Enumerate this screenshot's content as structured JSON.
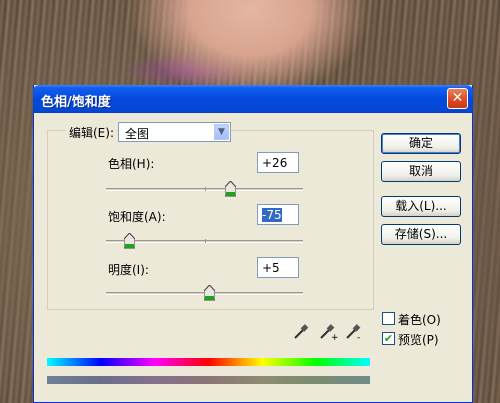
{
  "dialog": {
    "title": "色相/饱和度",
    "close_symbol": "✕"
  },
  "edit": {
    "label": "编辑(E):",
    "selected": "全图",
    "dropdown_arrow": "▼"
  },
  "hue": {
    "label": "色相(H):",
    "value": "+26",
    "slider_fraction": 0.63
  },
  "saturation": {
    "label": "饱和度(A):",
    "value": "-75",
    "slider_fraction": 0.125
  },
  "lightness": {
    "label": "明度(I):",
    "value": "+5",
    "slider_fraction": 0.525
  },
  "buttons": {
    "ok": "确定",
    "cancel": "取消",
    "load": "载入(L)...",
    "save": "存储(S)..."
  },
  "options": {
    "colorize": {
      "label": "着色(O)",
      "checked": false
    },
    "preview": {
      "label": "预览(P)",
      "checked": true,
      "check_symbol": "✔"
    }
  },
  "icons": [
    "eyedropper-icon",
    "eyedropper-plus-icon",
    "eyedropper-minus-icon"
  ]
}
